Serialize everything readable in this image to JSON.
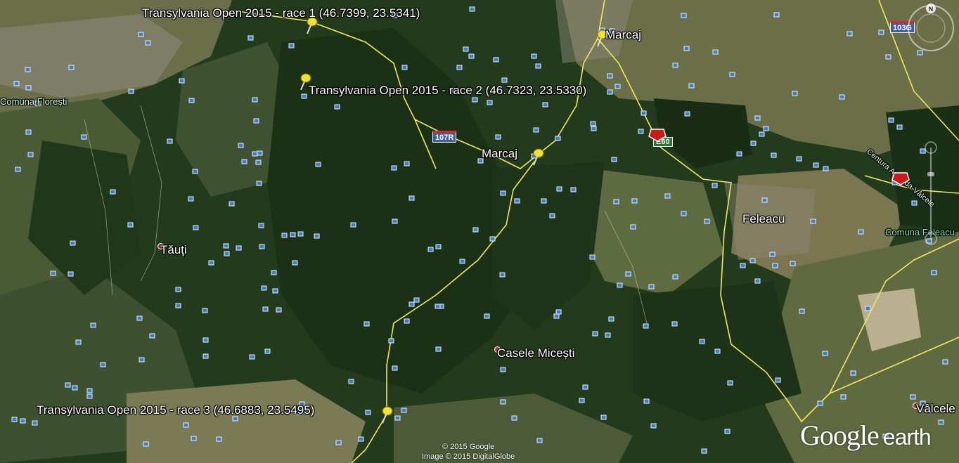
{
  "pins": [
    {
      "label": "Transylvania Open 2015 - race 1 (46.7399, 23.5341)"
    },
    {
      "label": "Transylvania Open 2015 - race 2 (46.7323, 23.5330)"
    },
    {
      "label": "Transylvania Open 2015 - race 3 (46.6883, 23.5495)"
    },
    {
      "label": "Marcaj"
    },
    {
      "label": "Marcaj"
    }
  ],
  "places": {
    "tauti": "Tăuţi",
    "casele": "Casele Micești",
    "feleacu": "Feleacu",
    "valcele": "Vâlcele",
    "comuna_floresti": "Comuna Florești",
    "comuna_feleacu": "Comuna Feleacu",
    "centura": "Centura Apahida-Vâlcele"
  },
  "roads": {
    "r107r": "107R",
    "e60": "E60",
    "r103g": "103G"
  },
  "compass": {
    "north": "N"
  },
  "attribution": {
    "line1": "© 2015 Google",
    "line2": "Image © 2015 DigitalGlobe"
  },
  "logo": {
    "google": "Google",
    "earth": "earth"
  },
  "colors": {
    "road": "#f2e85a",
    "forest": "#1f3a1a",
    "field": "#6d7a4a",
    "pin": "#f5e12a"
  }
}
